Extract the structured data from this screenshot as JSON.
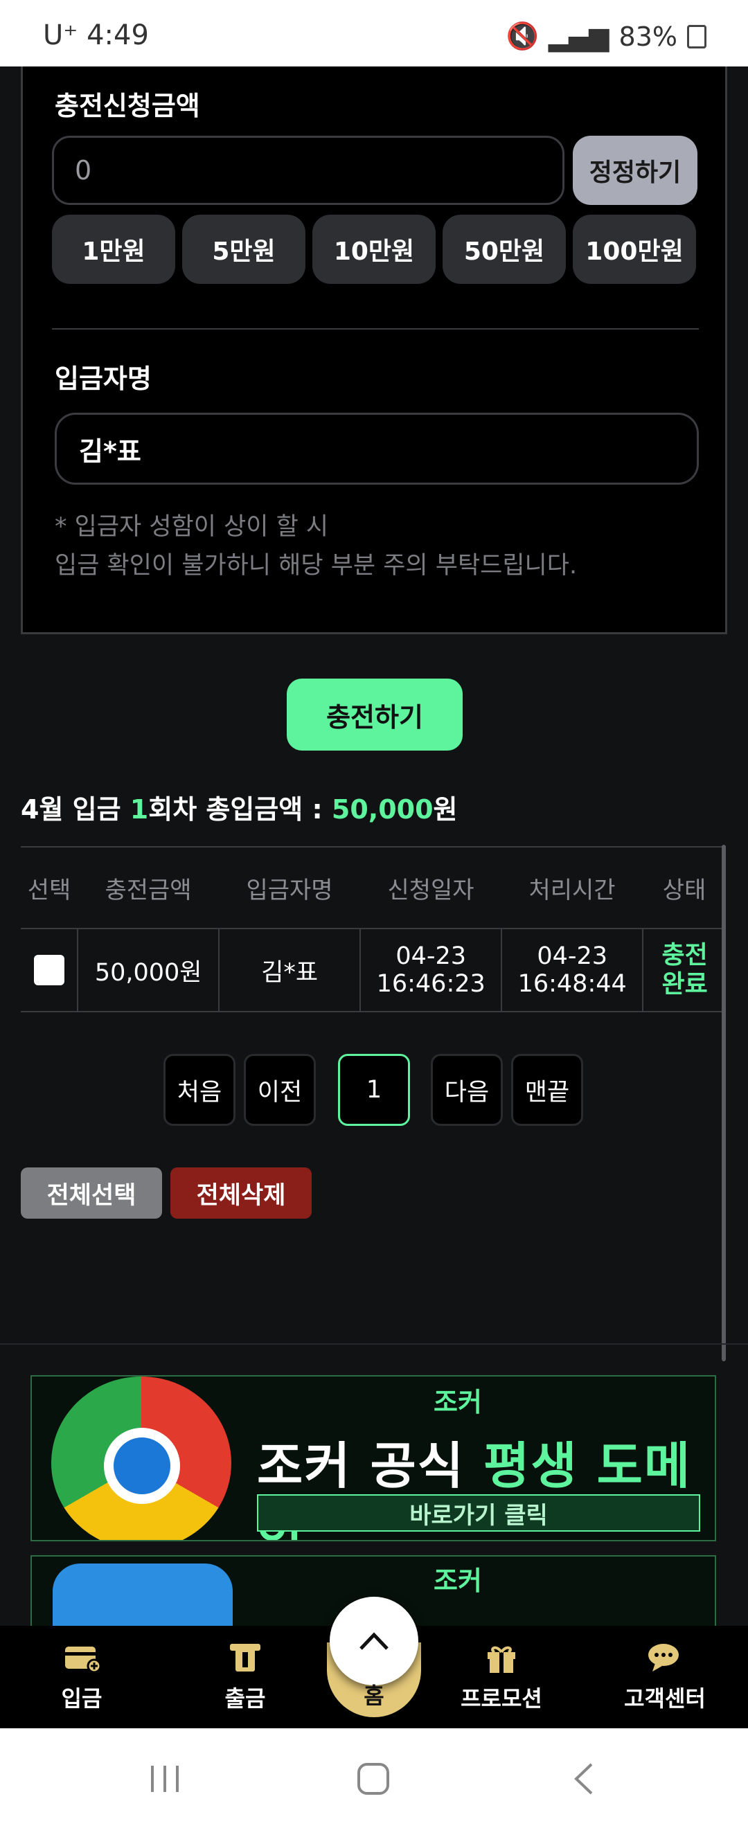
{
  "status_bar": {
    "time": "U⁺ 4:49",
    "battery": "83%"
  },
  "form": {
    "amount_label": "충전신청금액",
    "amount_value": "0",
    "reset_label": "정정하기",
    "quick_amounts": [
      "1만원",
      "5만원",
      "10만원",
      "50만원",
      "100만원"
    ],
    "depositor_label": "입금자명",
    "depositor_value": "김*표",
    "notice_line1": "* 입금자 성함이 상이 할 시",
    "notice_line2": "입금 확인이 불가하니 해당 부분 주의 부탁드립니다."
  },
  "submit_label": "충전하기",
  "summary": {
    "prefix": "4월 입금 ",
    "count": "1",
    "middle": "회차 총입금액 : ",
    "amount": "50,000",
    "suffix": "원"
  },
  "table": {
    "headers": [
      "선택",
      "충전금액",
      "입금자명",
      "신청일자",
      "처리시간",
      "상태"
    ],
    "rows": [
      {
        "amount": "50,000원",
        "name": "김*표",
        "request_date": "04-23",
        "request_time": "16:46:23",
        "process_date": "04-23",
        "process_time": "16:48:44",
        "status_line1": "충전",
        "status_line2": "완료"
      }
    ]
  },
  "pagination": {
    "first": "처음",
    "prev": "이전",
    "current": "1",
    "next": "다음",
    "last": "맨끝"
  },
  "actions": {
    "select_all": "전체선택",
    "delete_all": "전체삭제"
  },
  "banner": {
    "brand": "조커",
    "title_white1": "조커 공식 ",
    "title_green": "평생 도메인",
    "subtitle": "바로가기 클릭"
  },
  "bottom_nav": {
    "deposit": "입금",
    "withdraw": "출금",
    "home": "홈",
    "promotion": "프로모션",
    "support": "고객센터"
  },
  "colors": {
    "accent": "#5ef39d",
    "delete": "#8a1f1a",
    "select_all": "#7c7d80",
    "home": "#e4c879"
  }
}
